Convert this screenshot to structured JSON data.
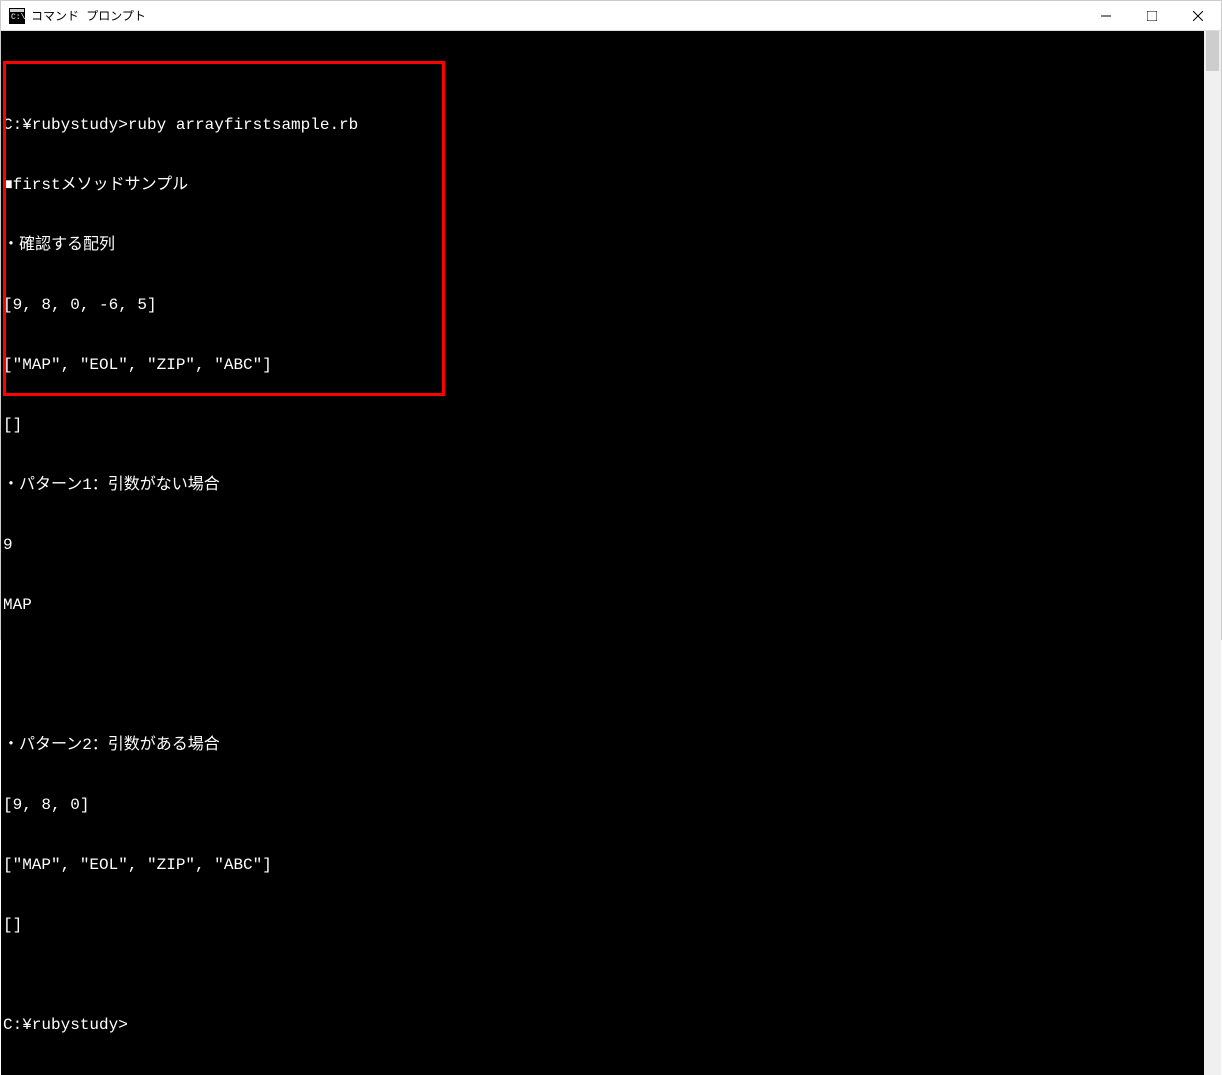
{
  "window": {
    "title": "コマンド プロンプト"
  },
  "terminal": {
    "lines": [
      "",
      "C:¥rubystudy>ruby arrayfirstsample.rb",
      "■firstメソッドサンプル",
      "・確認する配列",
      "[9, 8, 0, -6, 5]",
      "[\"MAP\", \"EOL\", \"ZIP\", \"ABC\"]",
      "[]",
      "・パターン1：引数がない場合",
      "9",
      "MAP",
      "",
      "",
      "・パターン2：引数がある場合",
      "[9, 8, 0]",
      "[\"MAP\", \"EOL\", \"ZIP\", \"ABC\"]",
      "[]",
      "",
      "C:¥rubystudy>"
    ]
  }
}
